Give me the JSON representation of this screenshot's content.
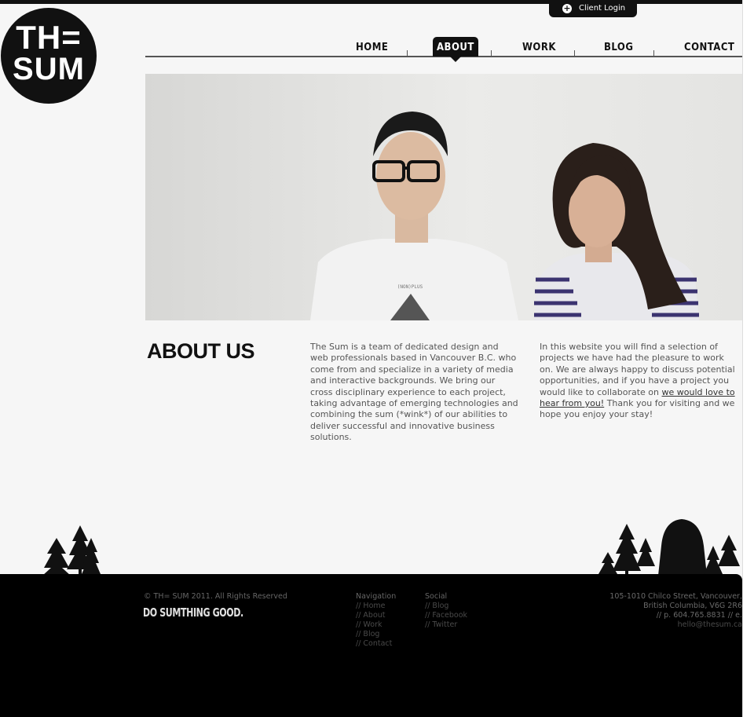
{
  "header": {
    "client_login_label": "Client Login",
    "logo": {
      "line1": "TH=",
      "line2": "SUM"
    }
  },
  "nav": {
    "items": [
      {
        "label": "HOME"
      },
      {
        "label": "ABOUT",
        "active": true
      },
      {
        "label": "WORK"
      },
      {
        "label": "BLOG"
      },
      {
        "label": "CONTACT"
      }
    ]
  },
  "hero": {
    "shirt_text": "(NON)PLUS"
  },
  "about": {
    "title": "ABOUT US",
    "paragraph1": "The Sum is a team of dedicated design and web professionals based in Vancouver B.C. who come from and specialize in a variety of media and interactive backgrounds. We bring our cross disciplinary experience to each project, taking advantage of emerging technologies and combining the sum (*wink*) of our abilities to deliver successful and innovative business solutions.",
    "paragraph2_before": "In this website you will find a selection of projects we have had the pleasure to work on. We are always happy to discuss potential opportunities, and if you have a project you would like to collaborate on ",
    "paragraph2_link": "we would love to hear from you!",
    "paragraph2_after": " Thank you for visiting and we hope you enjoy your stay!"
  },
  "footer": {
    "copyright": "© TH= SUM 2011. All Rights Reserved",
    "tagline": "DO SUMTHING GOOD.",
    "navigation_heading": "Navigation",
    "navigation_links": [
      "// Home",
      "// About",
      "// Work",
      "// Blog",
      "// Contact"
    ],
    "social_heading": "Social",
    "social_links": [
      "// Blog",
      "// Facebook",
      "// Twitter"
    ],
    "address_line1": "105-1010 Chilco Street, Vancouver,",
    "address_line2": "British Columbia, V6G 2R6",
    "phone": "// p. 604.765.8831 // e.",
    "email": "hello@thesum.ca"
  },
  "colors": {
    "accent": "#111111",
    "page_bg": "#f6f6f6",
    "footer_bg": "#000000"
  }
}
